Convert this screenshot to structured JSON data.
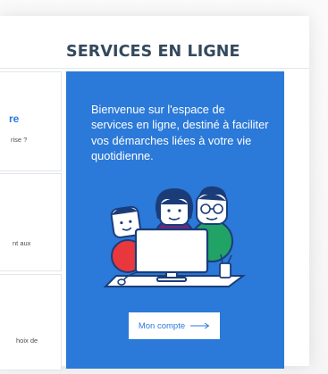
{
  "section": {
    "title": "SERVICES EN LIGNE"
  },
  "cards": [
    {
      "title_fragment": "re",
      "text_fragment": "rise ?"
    },
    {
      "text_fragment": "nt aux"
    },
    {
      "text_fragment": "hoix de"
    }
  ],
  "promo": {
    "text": "Bienvenue sur l'espace de services en ligne, destiné à faciliter vos démarches liées à votre vie quotidienne.",
    "button_label": "Mon compte",
    "background": "#2b79d8"
  },
  "icons": {
    "illustration": "family-computer-illustration",
    "arrow": "arrow-right-icon"
  },
  "colors": {
    "accent": "#2b79d8",
    "title": "#34495e"
  }
}
